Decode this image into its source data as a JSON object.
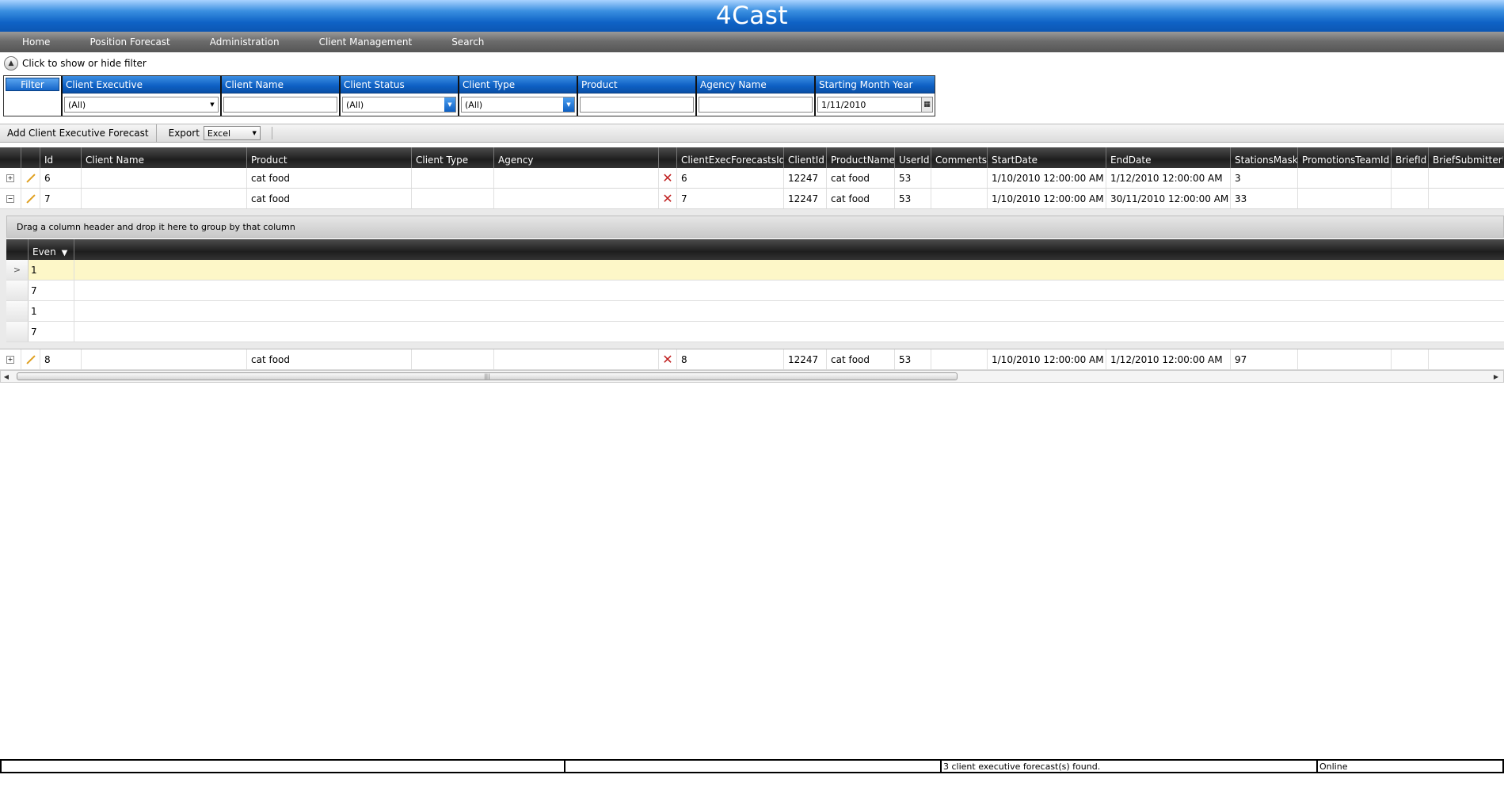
{
  "app": {
    "title": "4Cast"
  },
  "menu": [
    "Home",
    "Position Forecast",
    "Administration",
    "Client Management",
    "Search"
  ],
  "filter_toggle": {
    "label": "Click to show or hide filter"
  },
  "filter": {
    "button_label": "Filter",
    "columns": [
      {
        "header": "Client Executive",
        "value": "(All)"
      },
      {
        "header": "Client Name",
        "value": ""
      },
      {
        "header": "Client Status",
        "value": "(All)"
      },
      {
        "header": "Client Type",
        "value": "(All)"
      },
      {
        "header": "Product",
        "value": ""
      },
      {
        "header": "Agency Name",
        "value": ""
      },
      {
        "header": "Starting Month Year",
        "value": "1/11/2010"
      }
    ]
  },
  "toolbar": {
    "add_label": "Add Client Executive Forecast",
    "export_label": "Export",
    "export_value": "Excel"
  },
  "grid": {
    "headers": [
      "Id",
      "Client Name",
      "Product",
      "Client Type",
      "Agency",
      "ClientExecForecastsId",
      "ClientId",
      "ProductName",
      "UserId",
      "Comments",
      "StartDate",
      "EndDate",
      "StationsMask",
      "PromotionsTeamId",
      "BriefId",
      "BriefSubmitterUserId"
    ],
    "rows": [
      {
        "expander": "+",
        "id": "6",
        "client_name": "",
        "product": "cat food",
        "client_type": "",
        "agency": "",
        "forecasts_id": "6",
        "client_id": "12247",
        "product_name": "cat food",
        "user_id": "53",
        "comments": "",
        "start": "1/10/2010 12:00:00 AM",
        "end": "1/12/2010 12:00:00 AM",
        "stations": "3",
        "team": "",
        "brief": "",
        "submitter": ""
      },
      {
        "expander": "−",
        "id": "7",
        "client_name": "",
        "product": "cat food",
        "client_type": "",
        "agency": "",
        "forecasts_id": "7",
        "client_id": "12247",
        "product_name": "cat food",
        "user_id": "53",
        "comments": "",
        "start": "1/10/2010 12:00:00 AM",
        "end": "30/11/2010 12:00:00 AM",
        "stations": "33",
        "team": "",
        "brief": "",
        "submitter": ""
      },
      {
        "expander": "+",
        "id": "8",
        "client_name": "",
        "product": "cat food",
        "client_type": "",
        "agency": "",
        "forecasts_id": "8",
        "client_id": "12247",
        "product_name": "cat food",
        "user_id": "53",
        "comments": "",
        "start": "1/10/2010 12:00:00 AM",
        "end": "1/12/2010 12:00:00 AM",
        "stations": "97",
        "team": "",
        "brief": "",
        "submitter": ""
      }
    ]
  },
  "detail": {
    "group_hint": "Drag a column header and drop it here to group by that column",
    "column": "Even",
    "rows": [
      "1",
      "7",
      "1",
      "7"
    ],
    "selected_indicator": ">"
  },
  "status": {
    "message": "3 client executive forecast(s) found.",
    "connection": "Online"
  },
  "colors": {
    "title_blue": "#0f63c6",
    "menu_gray": "#6c6c6c",
    "header_dark": "#1e1e1e",
    "selected_row": "#fdf7c8",
    "delete_red": "#c02020"
  }
}
